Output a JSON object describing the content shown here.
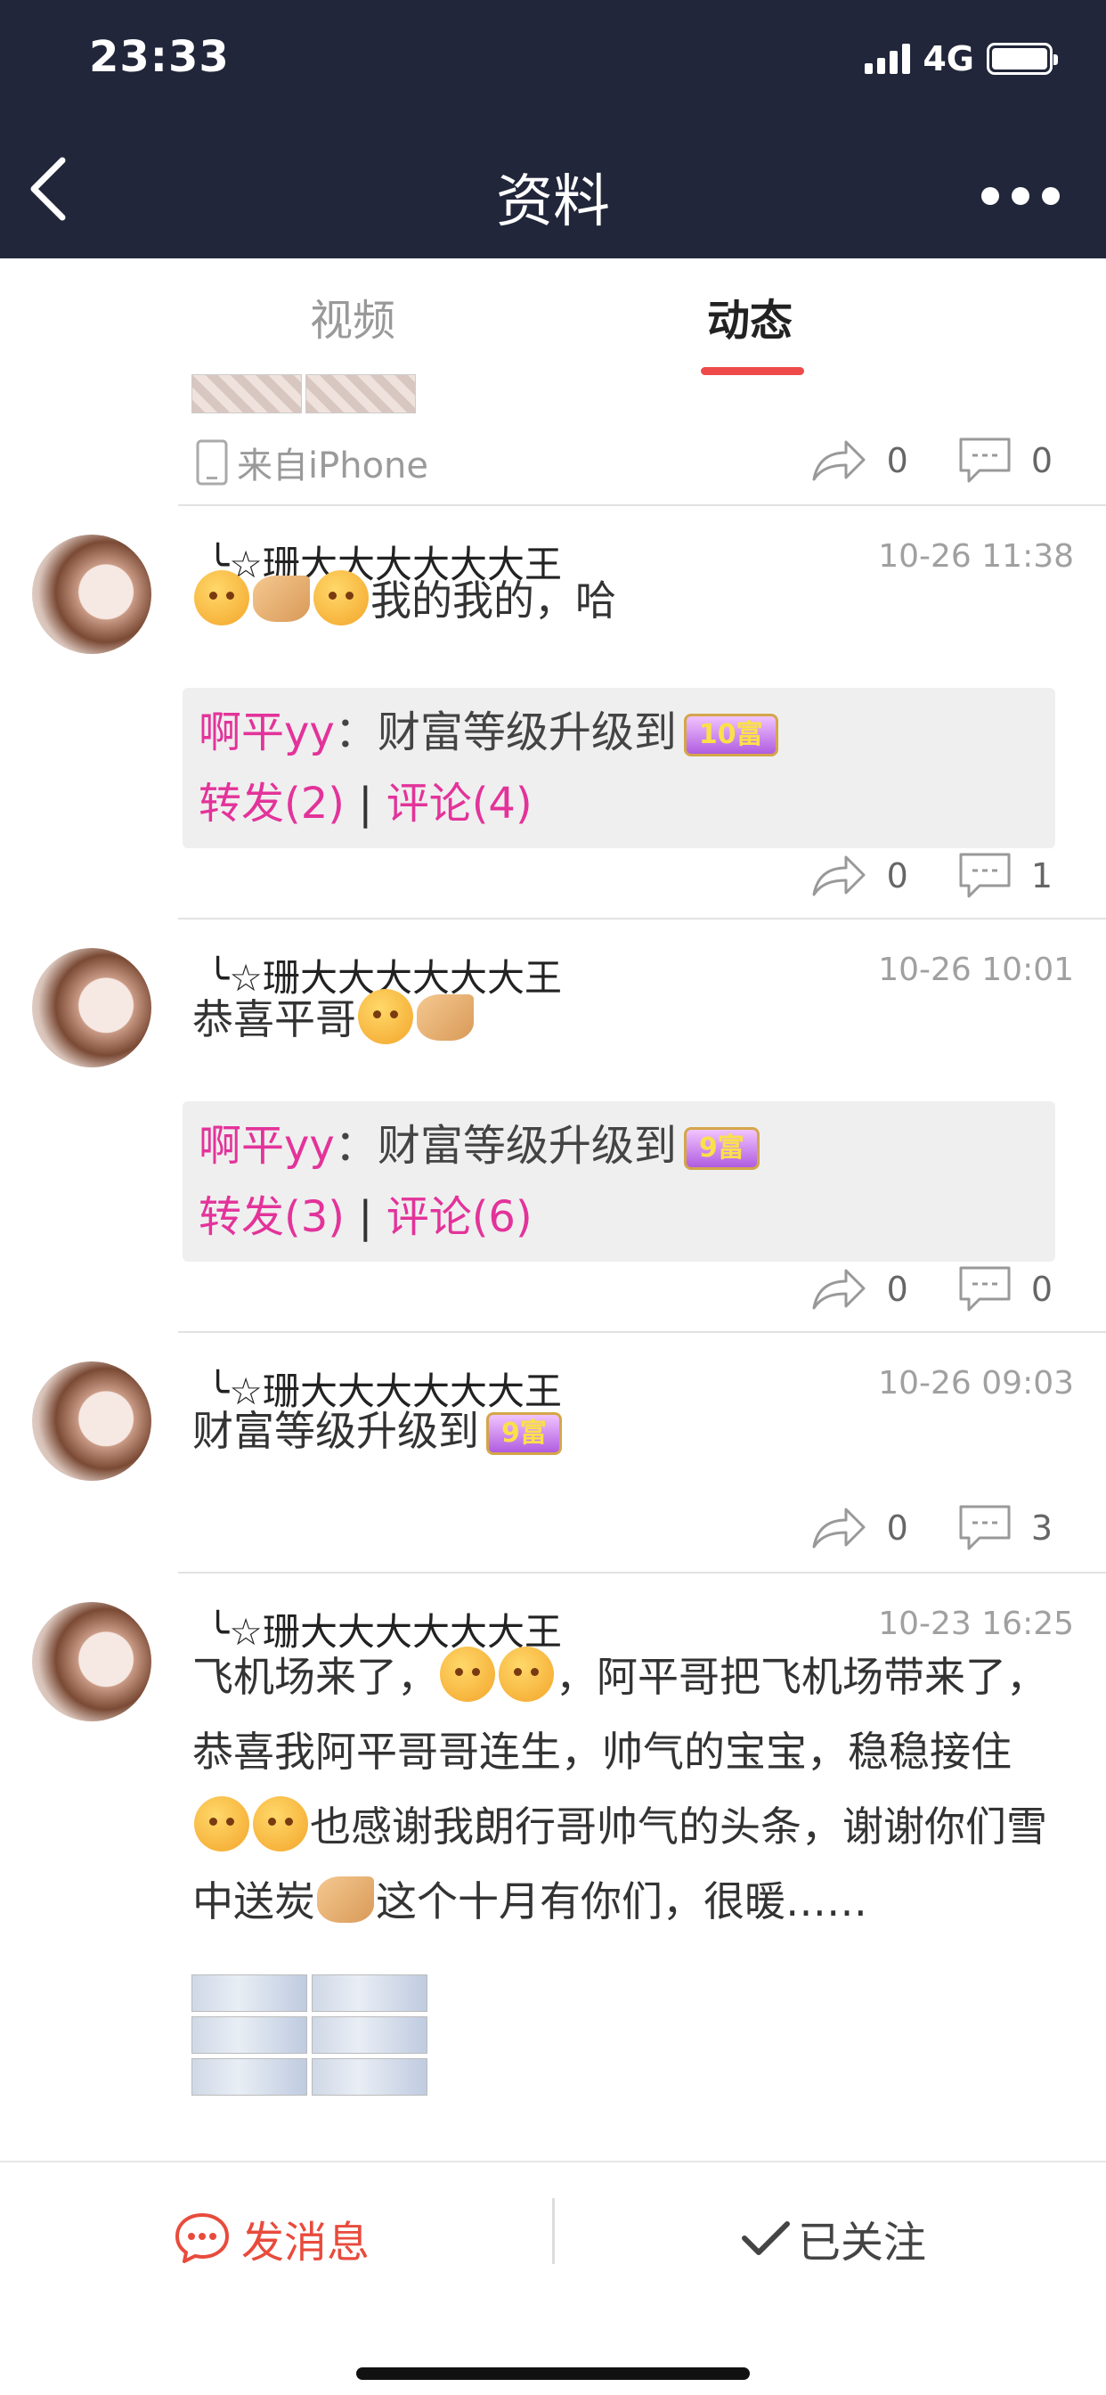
{
  "status_bar": {
    "time": "23:33",
    "network": "4G"
  },
  "header": {
    "title": "资料"
  },
  "tabs": [
    {
      "label": "视频",
      "active": false
    },
    {
      "label": "动态",
      "active": true
    }
  ],
  "first_partial": {
    "source": "来自iPhone",
    "share_count": "0",
    "comment_count": "0"
  },
  "posts": [
    {
      "name": "╰☆珊大大大大大大王",
      "time": "10-26 11:38",
      "text": "我的我的，哈",
      "share": {
        "user": "啊平yy",
        "colon": "：",
        "text": "财富等级升级到",
        "badge": "10富",
        "forward": "转发(2)",
        "sep": "|",
        "comment": "评论(4)"
      },
      "share_count": "0",
      "comment_count": "1"
    },
    {
      "name": "╰☆珊大大大大大大王",
      "time": "10-26 10:01",
      "text": "恭喜平哥",
      "share": {
        "user": "啊平yy",
        "colon": "：",
        "text": "财富等级升级到",
        "badge": "9富",
        "forward": "转发(3)",
        "sep": "|",
        "comment": "评论(6)"
      },
      "share_count": "0",
      "comment_count": "0"
    },
    {
      "name": "╰☆珊大大大大大大王",
      "time": "10-26 09:03",
      "text": "财富等级升级到",
      "badge": "9富",
      "share_count": "0",
      "comment_count": "3"
    },
    {
      "name": "╰☆珊大大大大大大王",
      "time": "10-23 16:25",
      "text_1": "飞机场来了，",
      "text_2": "，阿平哥把飞机场带来了，恭喜我阿平哥哥连生，帅气的宝宝，稳稳接住",
      "text_3": "也感谢我朗行哥帅气的头条，谢谢你们雪中送炭",
      "text_4": "这个十月有你们，很暖……"
    }
  ],
  "bottom_bar": {
    "message_label": "发消息",
    "follow_label": "已关注"
  },
  "colors": {
    "header_bg": "#21263a",
    "accent": "#ee4a4a",
    "pink": "#e3339a",
    "message": "#e84b3c"
  }
}
